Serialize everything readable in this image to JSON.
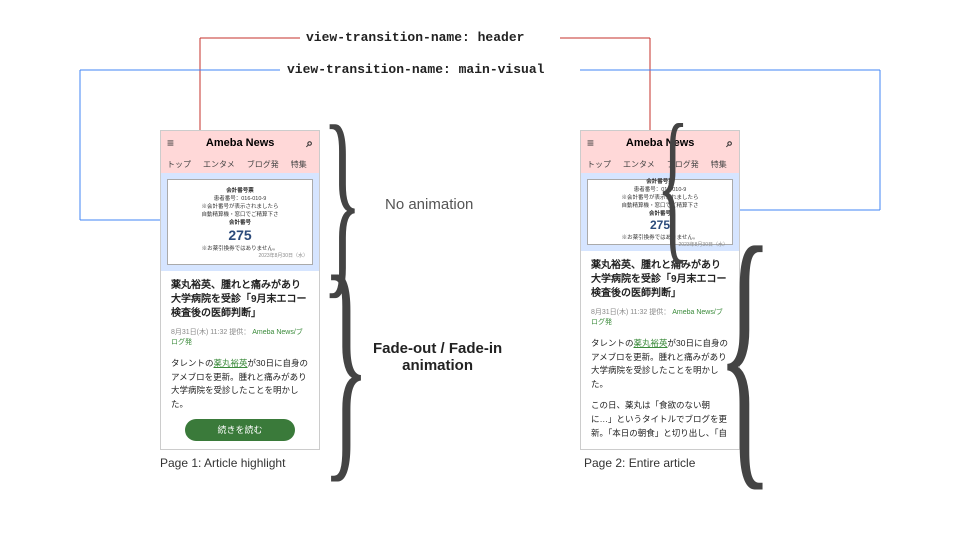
{
  "labels": {
    "header": "view-transition-name: header",
    "main_visual": "view-transition-name: main-visual"
  },
  "annotations": {
    "no_anim": "No animation",
    "fade": "Fade-out / Fade-in\nanimation"
  },
  "captions": {
    "p1": "Page 1: Article highlight",
    "p2": "Page 2: Entire article"
  },
  "app": {
    "logo": "Ameba News",
    "tabs": [
      "トップ",
      "エンタメ",
      "ブログ発",
      "特集"
    ],
    "ticket": {
      "title": "会計番号票",
      "idline": "患者番号：016-010-9",
      "note1": "※会計番号が表示されましたら",
      "note2": "自動精算機・窓口でご精算下さ",
      "label": "会計番号",
      "number": "275",
      "note3": "※お薬引換券ではありません。",
      "date": "2023年8月30日（水）"
    },
    "article": {
      "title": "薬丸裕英、腫れと痛みがあり大学病院を受診「9月末エコー検査後の医師判断」",
      "meta_date": "8月31日(木) 11:32",
      "meta_sep": "提供：",
      "meta_src": "Ameba News/ブログ発",
      "para1_a": "タレントの",
      "para1_link": "薬丸裕英",
      "para1_b": "が30日に自身のアメブロを更新。腫れと痛みがあり大学病院を受診したことを明かした。",
      "para2": "この日、薬丸は「食欲のない朝に…」というタイトルでブログを更新。「本日の朝食」と切り出し、「自",
      "cta": "続きを読む"
    }
  }
}
